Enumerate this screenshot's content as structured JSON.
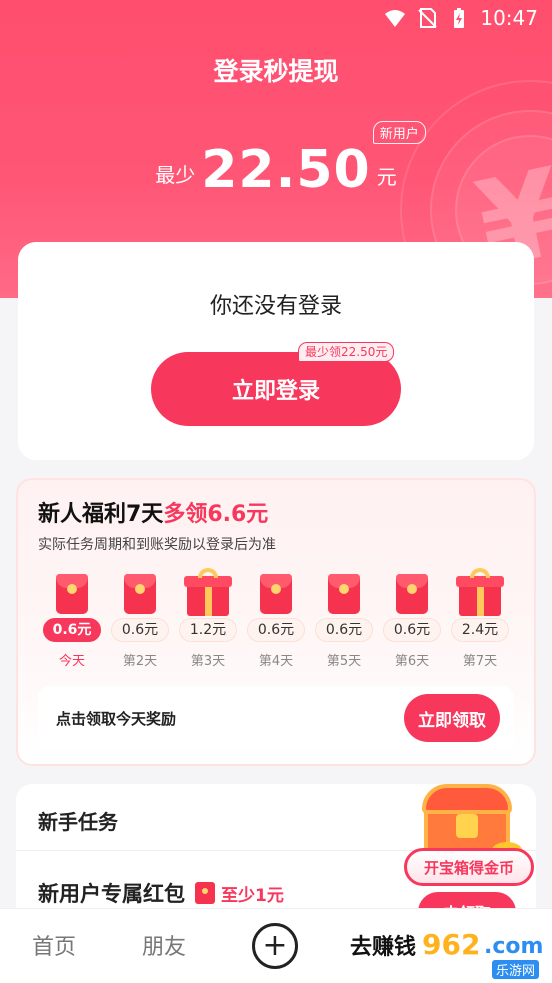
{
  "status_bar": {
    "time": "10:47"
  },
  "header": {
    "title": "登录秒提现",
    "amount_prefix": "最少",
    "amount": "22.50",
    "amount_unit": "元",
    "new_user_badge": "新用户"
  },
  "login_card": {
    "message": "你还没有登录",
    "button_label": "立即登录",
    "button_tag": "最少领22.50元"
  },
  "welfare": {
    "title_main": "新人福利7天",
    "title_highlight": "多领6.6元",
    "subtitle": "实际任务周期和到账奖励以登录后为准",
    "days": [
      {
        "amount": "0.6元",
        "label": "今天",
        "type": "envelope"
      },
      {
        "amount": "0.6元",
        "label": "第2天",
        "type": "envelope"
      },
      {
        "amount": "1.2元",
        "label": "第3天",
        "type": "gift"
      },
      {
        "amount": "0.6元",
        "label": "第4天",
        "type": "envelope"
      },
      {
        "amount": "0.6元",
        "label": "第5天",
        "type": "envelope"
      },
      {
        "amount": "0.6元",
        "label": "第6天",
        "type": "envelope"
      },
      {
        "amount": "2.4元",
        "label": "第7天",
        "type": "gift"
      }
    ],
    "claim_text": "点击领取今天奖励",
    "claim_button": "立即领取"
  },
  "tasks": {
    "heading": "新手任务",
    "items": [
      {
        "name": "新用户专属红包",
        "reward": "至少1元"
      }
    ]
  },
  "treasure": {
    "label": "开宝箱得金币",
    "button": "去领取"
  },
  "bottom_nav": {
    "items": [
      "首页",
      "朋友",
      "去赚钱"
    ],
    "plus": "+"
  },
  "watermark": {
    "num": "962",
    "com": ".com",
    "cn": "乐游网"
  },
  "colors": {
    "accent": "#f8375c",
    "hero": "#ff4e6e"
  }
}
